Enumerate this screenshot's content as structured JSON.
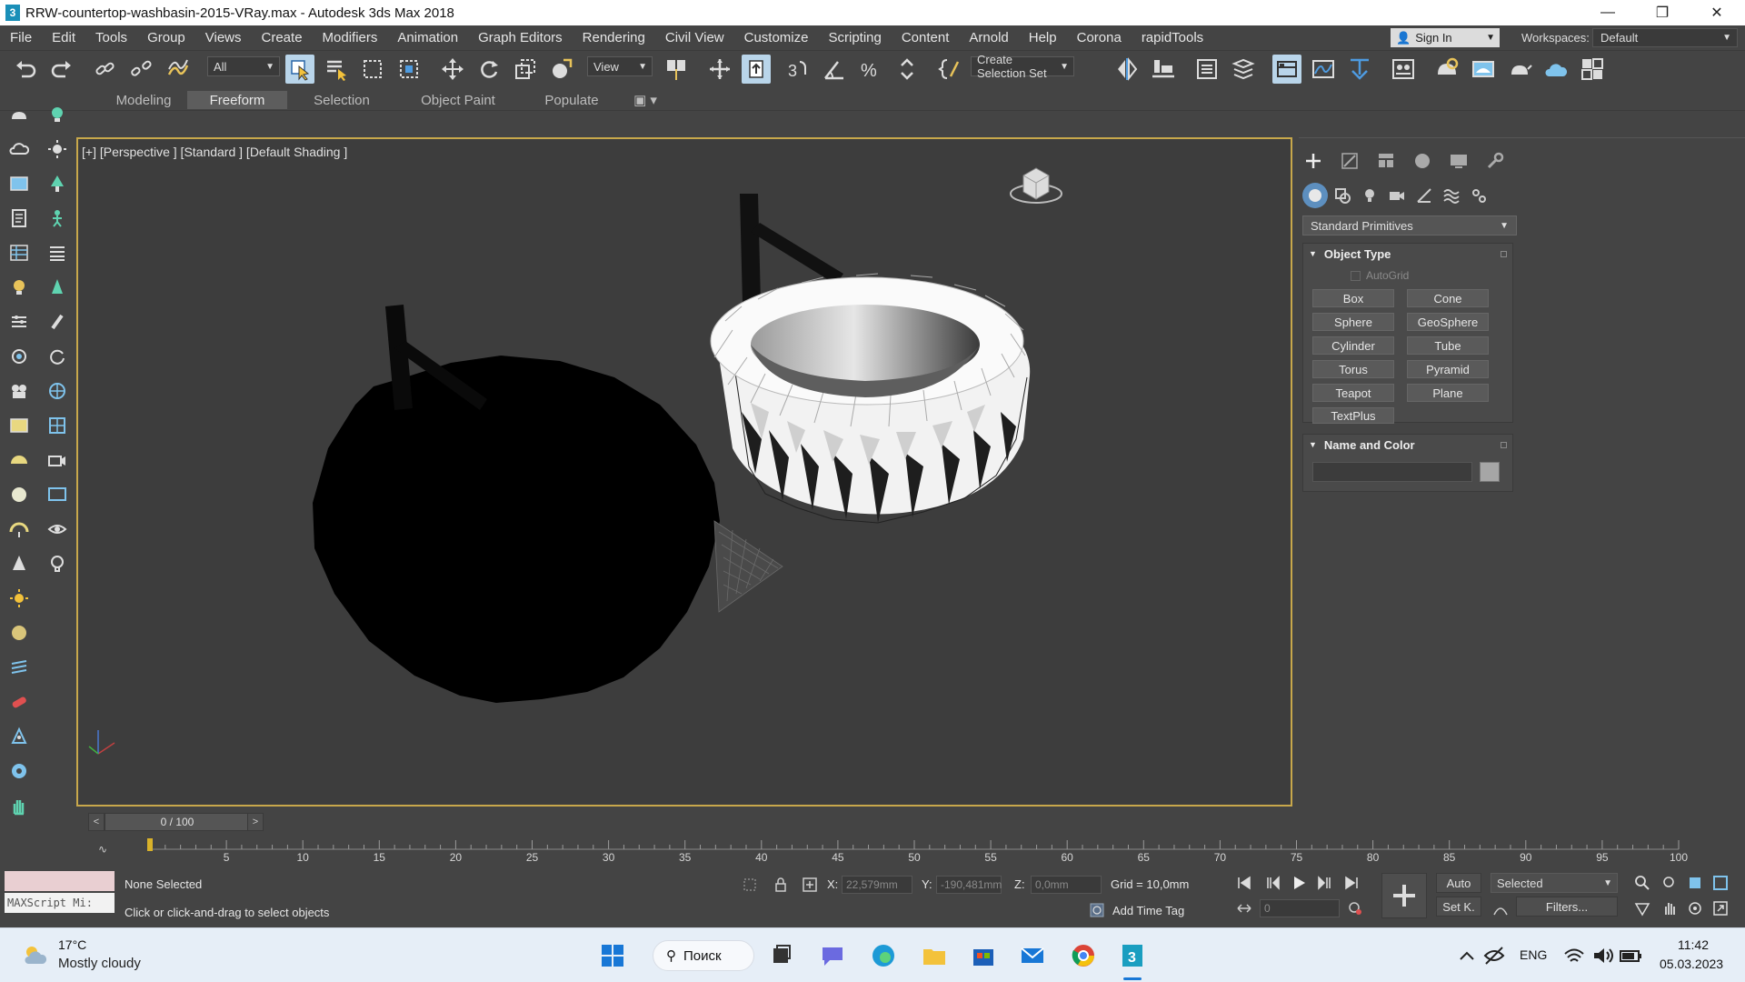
{
  "window": {
    "title": "RRW-countertop-washbasin-2015-VRay.max - Autodesk 3ds Max 2018",
    "app_icon": "3"
  },
  "menu": [
    "File",
    "Edit",
    "Tools",
    "Group",
    "Views",
    "Create",
    "Modifiers",
    "Animation",
    "Graph Editors",
    "Rendering",
    "Civil View",
    "Customize",
    "Scripting",
    "Content",
    "Arnold",
    "Help",
    "Corona",
    "rapidTools"
  ],
  "account": {
    "sign_in": "Sign In",
    "workspaces_label": "Workspaces:",
    "workspace": "Default"
  },
  "toolbar": {
    "filter": "All",
    "ref_coord": "View",
    "selection_set": "Create Selection Set"
  },
  "ribbon_tabs": [
    "Modeling",
    "Freeform",
    "Selection",
    "Object Paint",
    "Populate"
  ],
  "viewport": {
    "label": "[+] [Perspective ] [Standard ] [Default Shading ]"
  },
  "command_panel": {
    "category": "Standard Primitives",
    "object_type_title": "Object Type",
    "autogrid": "AutoGrid",
    "primitives": [
      "Box",
      "Cone",
      "Sphere",
      "GeoSphere",
      "Cylinder",
      "Tube",
      "Torus",
      "Pyramid",
      "Teapot",
      "Plane",
      "TextPlus"
    ],
    "name_color_title": "Name and Color",
    "object_color": "#a6a6a6"
  },
  "timeline": {
    "slider": "0 / 100",
    "prev": "<",
    "next": ">",
    "ticks": [
      "5",
      "10",
      "15",
      "20",
      "25",
      "30",
      "35",
      "40",
      "45",
      "50",
      "55",
      "60",
      "65",
      "70",
      "75",
      "80",
      "85",
      "90",
      "95",
      "100"
    ]
  },
  "status": {
    "maxscript": "MAXScript Mi:",
    "selection": "None Selected",
    "prompt": "Click or click-and-drag to select objects",
    "x_label": "X:",
    "x_value": "22,579mm",
    "y_label": "Y:",
    "y_value": "-190,481mm",
    "z_label": "Z:",
    "z_value": "0,0mm",
    "grid": "Grid = 10,0mm",
    "add_time_tag": "Add Time Tag",
    "auto": "Auto",
    "set_key": "Set K.",
    "key_filter": "Selected",
    "filters": "Filters...",
    "frame": "0"
  },
  "taskbar": {
    "temp": "17°C",
    "weather": "Mostly cloudy",
    "search": "Поиск",
    "lang": "ENG",
    "time": "11:42",
    "date": "05.03.2023"
  },
  "colors": {
    "viewport_border": "#c8a84b",
    "active_button": "#b9d5ea",
    "panel": "#444444"
  }
}
